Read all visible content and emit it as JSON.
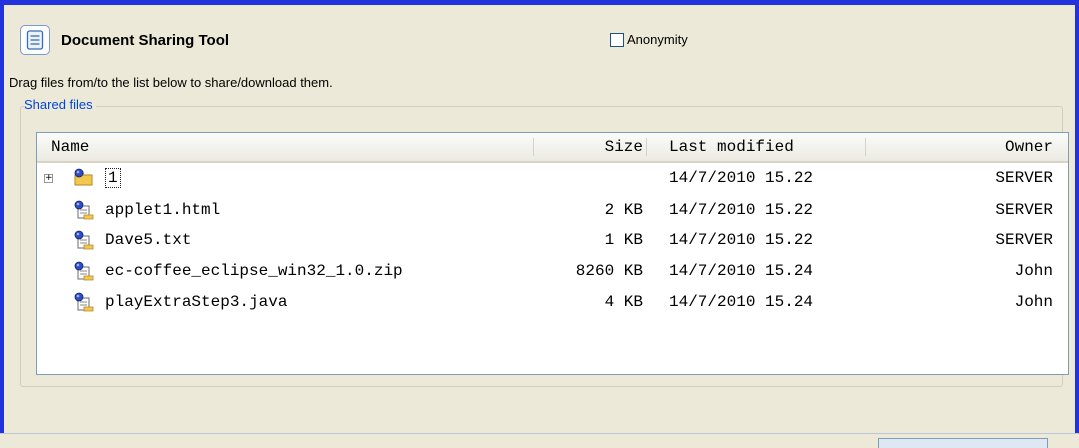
{
  "app": {
    "title": "Document Sharing Tool",
    "icon": "document-icon"
  },
  "anonymity": {
    "label": "Anonymity",
    "checked": false
  },
  "hint": "Drag files from/to the list below to share/download them.",
  "group": {
    "label": "Shared files"
  },
  "table": {
    "columns": {
      "name": "Name",
      "size": "Size",
      "modified": "Last modified",
      "owner": "Owner"
    },
    "rows": [
      {
        "name": "1",
        "size": "",
        "modified": "14/7/2010 15.22",
        "owner": "SERVER",
        "type": "folder",
        "icon": "shared-folder-icon",
        "expandable": true,
        "expander": "+"
      },
      {
        "name": "applet1.html",
        "size": "2 KB",
        "modified": "14/7/2010 15.22",
        "owner": "SERVER",
        "type": "file",
        "icon": "shared-file-icon"
      },
      {
        "name": "Dave5.txt",
        "size": "1 KB",
        "modified": "14/7/2010 15.22",
        "owner": "SERVER",
        "type": "file",
        "icon": "shared-file-icon"
      },
      {
        "name": "ec-coffee_eclipse_win32_1.0.zip",
        "size": "8260 KB",
        "modified": "14/7/2010 15.24",
        "owner": "John",
        "type": "file",
        "icon": "shared-file-icon"
      },
      {
        "name": "playExtraStep3.java",
        "size": "4 KB",
        "modified": "14/7/2010 15.24",
        "owner": "John",
        "type": "file",
        "icon": "shared-file-icon"
      }
    ]
  },
  "colors": {
    "window_border": "#2233dd",
    "panel_bg": "#ece9d8",
    "group_label": "#0046d5",
    "list_border": "#7f9db9"
  }
}
